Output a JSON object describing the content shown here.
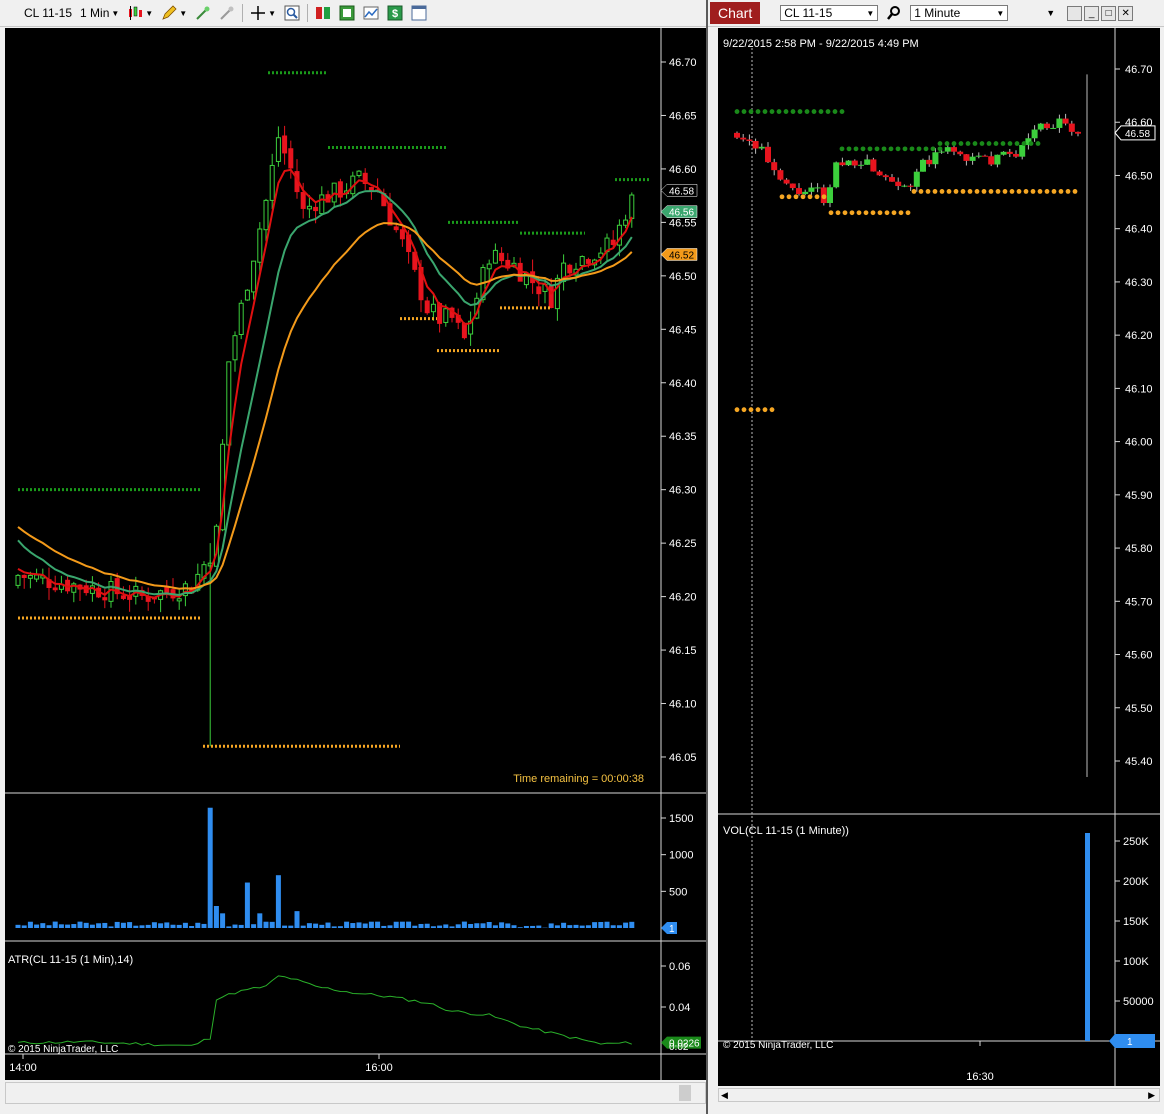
{
  "left": {
    "toolbar": {
      "instrument": "CL 11-15",
      "interval": "1 Min"
    },
    "price_axis": [
      "46.70",
      "46.65",
      "46.60",
      "46.55",
      "46.50",
      "46.45",
      "46.40",
      "46.35",
      "46.30",
      "46.25",
      "46.20",
      "46.15",
      "46.10",
      "46.05"
    ],
    "tags": {
      "last": "46.58",
      "ma_green": "46.56",
      "ma_orange": "46.52"
    },
    "time_remaining": "Time remaining = 00:00:38",
    "volume_axis": [
      "1500",
      "1000",
      "500"
    ],
    "volume_tag": "1",
    "atr_title": "ATR(CL 11-15 (1 Min),14)",
    "atr_axis": [
      "0.06",
      "0.04"
    ],
    "atr_tag": "0.0226",
    "atr_partial": "0.02",
    "copyright": "© 2015 NinjaTrader, LLC",
    "time_axis": [
      "14:00",
      "16:00"
    ]
  },
  "right": {
    "header": {
      "chart_label": "Chart",
      "instrument": "CL 11-15",
      "interval": "1 Minute"
    },
    "date_range": "9/22/2015 2:58 PM - 9/22/2015 4:49 PM",
    "price_axis": [
      "46.70",
      "46.60",
      "46.50",
      "46.40",
      "46.30",
      "46.20",
      "46.10",
      "46.00",
      "45.90",
      "45.80",
      "45.70",
      "45.60",
      "45.50",
      "45.40"
    ],
    "price_tag": "46.58",
    "vol_title": "VOL(CL 11-15 (1 Minute))",
    "vol_axis": [
      "250K",
      "200K",
      "150K",
      "100K",
      "50000"
    ],
    "vol_tag": "1",
    "copyright": "© 2015 NinjaTrader, LLC",
    "time_axis": [
      "16:30"
    ]
  },
  "colors": {
    "up": "#3ccf3c",
    "down": "#e8141e",
    "ema_red": "#e01010",
    "ema_green": "#3aa66e",
    "ema_orange": "#f39a1a",
    "dot_green": "#1a9a1a",
    "dot_orange": "#f5a623",
    "vol_blue": "#2f8df0"
  }
}
